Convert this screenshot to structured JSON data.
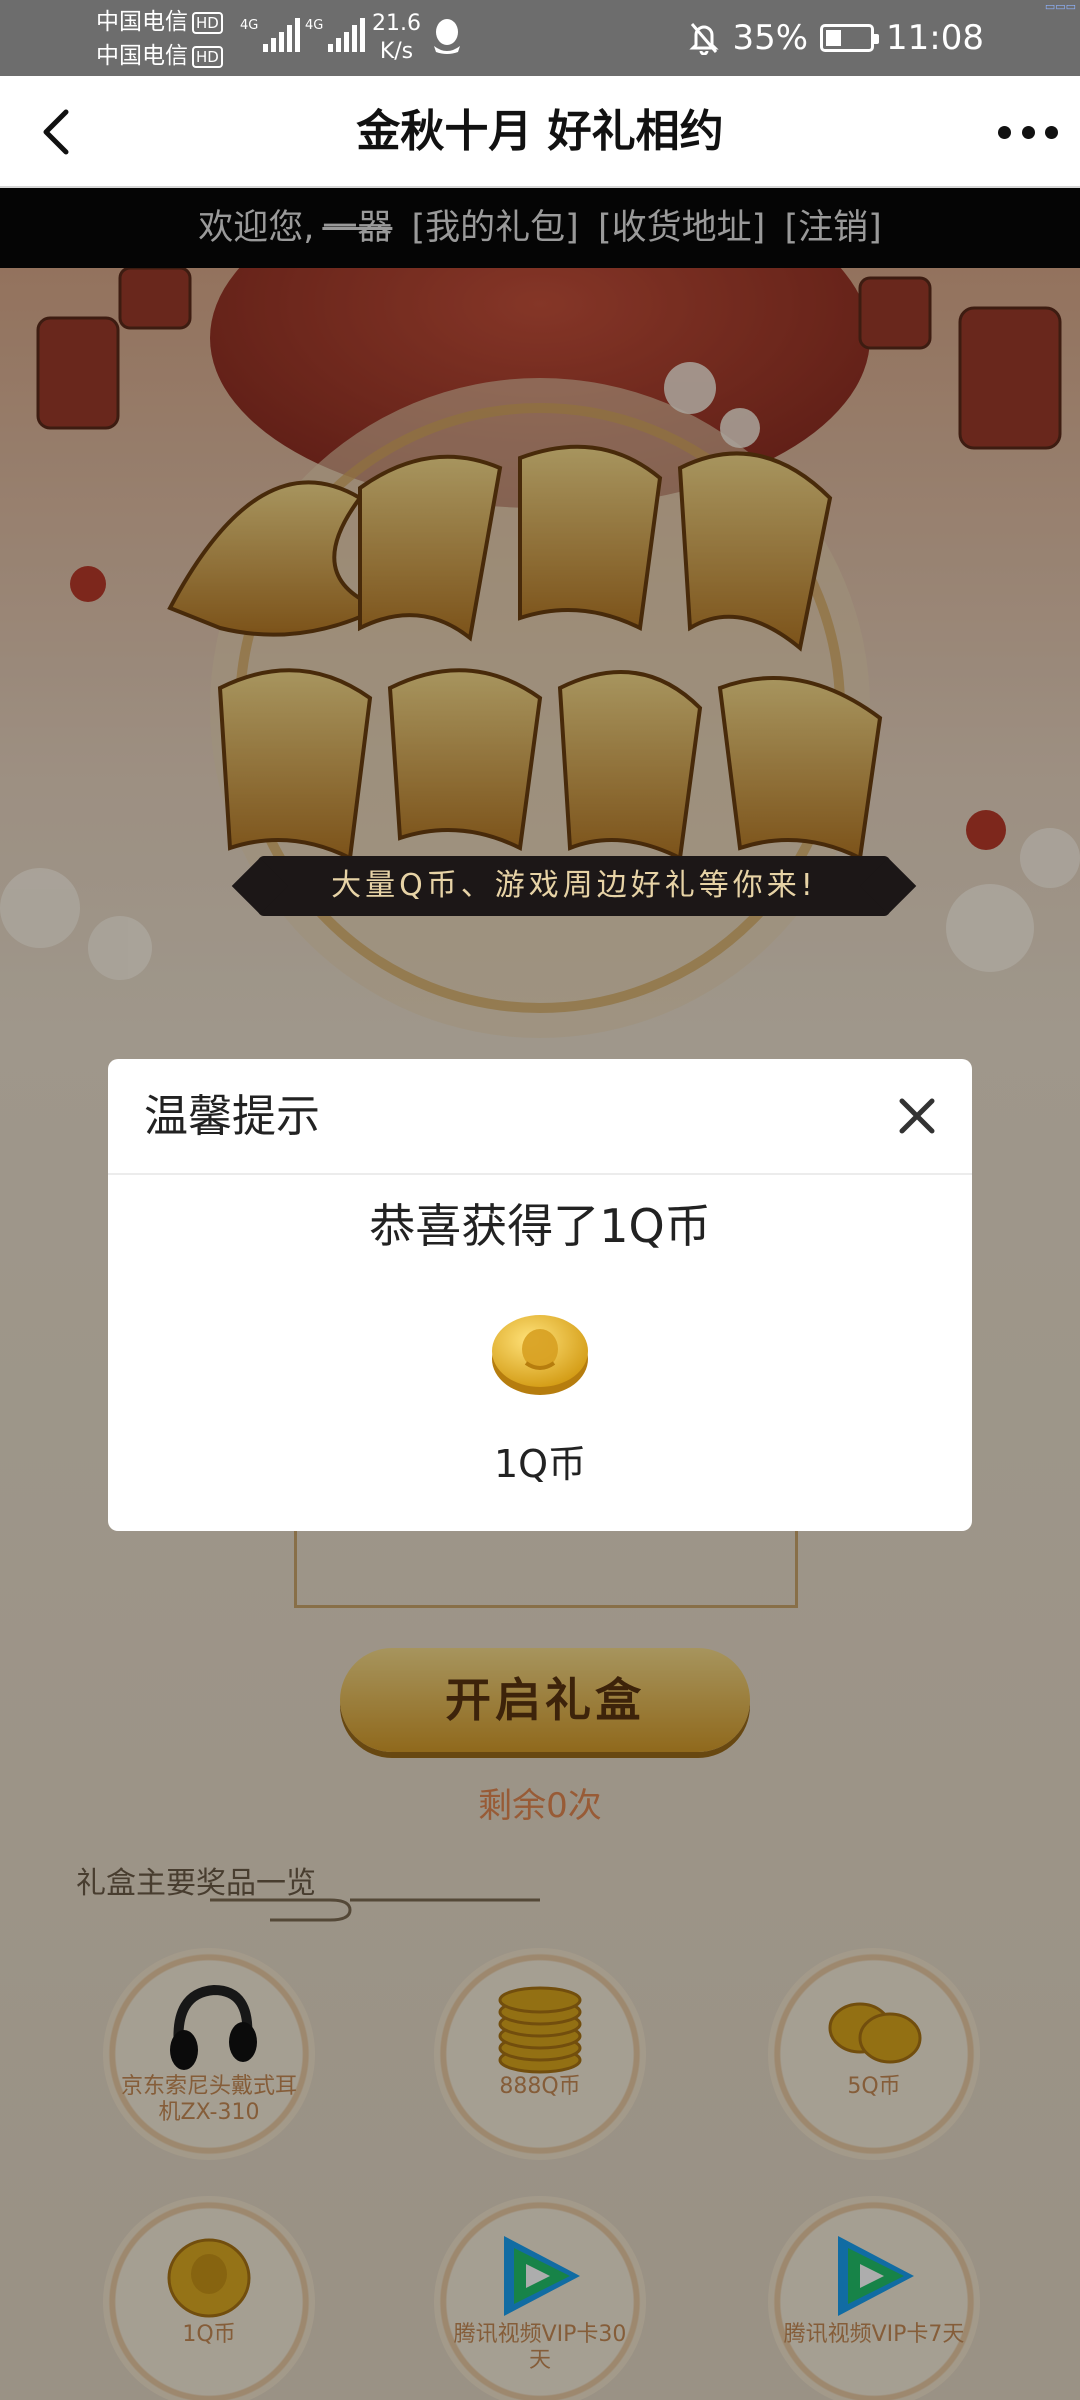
{
  "status_bar": {
    "carrier1": "中国电信",
    "carrier2": "中国电信",
    "hd_badge": "HD",
    "network1": "4G",
    "network2": "4G",
    "speed_value": "21.6",
    "speed_unit": "K/s",
    "battery_percent": "35%",
    "battery_level": 0.35,
    "time": "11:08"
  },
  "navbar": {
    "title": "金秋十月 好礼相约"
  },
  "welcome_bar": {
    "greeting": "欢迎您,",
    "username": "一器",
    "my_gifts": "[我的礼包]",
    "address": "[收货地址]",
    "logout": "[注销]"
  },
  "banner": {
    "slogan": "大量Q币、游戏周边好礼等你来!"
  },
  "main": {
    "open_button": "开启礼盒",
    "remaining": "剩余0次",
    "prize_section_title": "礼盒主要奖品一览"
  },
  "prizes": [
    {
      "label": "京东索尼头戴式耳机ZX-310",
      "icon": "headphones-icon"
    },
    {
      "label": "888Q币",
      "icon": "coin-stack-icon"
    },
    {
      "label": "5Q币",
      "icon": "coins-icon"
    },
    {
      "label": "1Q币",
      "icon": "coin-icon"
    },
    {
      "label": "腾讯视频VIP卡30天",
      "icon": "tencent-video-icon"
    },
    {
      "label": "腾讯视频VIP卡7天",
      "icon": "tencent-video-icon"
    }
  ],
  "modal": {
    "title": "温馨提示",
    "message": "恭喜获得了1Q币",
    "prize_label": "1Q币"
  },
  "colors": {
    "status_bar_bg": "#6d6d6d",
    "welcome_bar_bg": "#050505",
    "accent_gold": "#d49b2a",
    "remaining_text": "#e08650"
  }
}
